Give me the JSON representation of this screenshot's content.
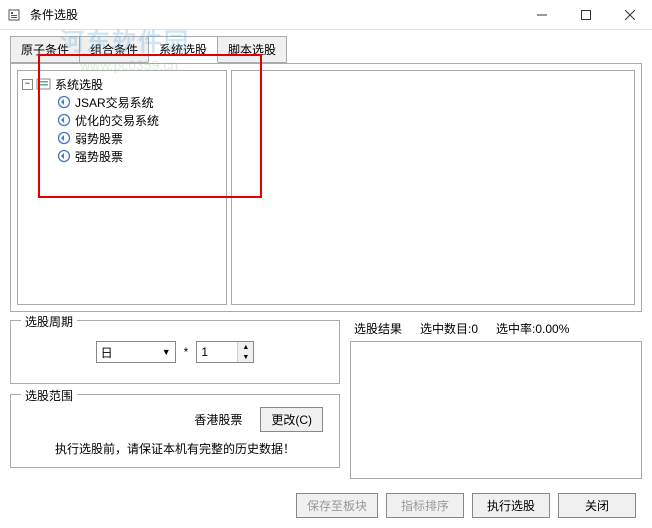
{
  "window": {
    "title": "条件选股"
  },
  "watermark": {
    "line1": "河东软件园",
    "line2": "www.pc0359.cn"
  },
  "tabs": {
    "items": [
      {
        "label": "原子条件"
      },
      {
        "label": "组合条件"
      },
      {
        "label": "系统选股"
      },
      {
        "label": "脚本选股"
      }
    ],
    "active": 2
  },
  "tree": {
    "root": {
      "label": "系统选股",
      "expanded": true
    },
    "children": [
      {
        "label": "JSAR交易系统"
      },
      {
        "label": "优化的交易系统"
      },
      {
        "label": "弱势股票"
      },
      {
        "label": "强势股票"
      }
    ]
  },
  "period": {
    "legend": "选股周期",
    "unit": "日",
    "star": "*",
    "value": "1"
  },
  "range": {
    "legend": "选股范围",
    "market": "香港股票",
    "change_btn": "更改(C)",
    "note": "执行选股前，请保证本机有完整的历史数据！"
  },
  "result": {
    "title": "选股结果",
    "count_label": "选中数目:0",
    "rate_label": "选中率:0.00%"
  },
  "footer": {
    "save": "保存至板块",
    "rank": "指标排序",
    "exec": "执行选股",
    "close": "关闭"
  }
}
